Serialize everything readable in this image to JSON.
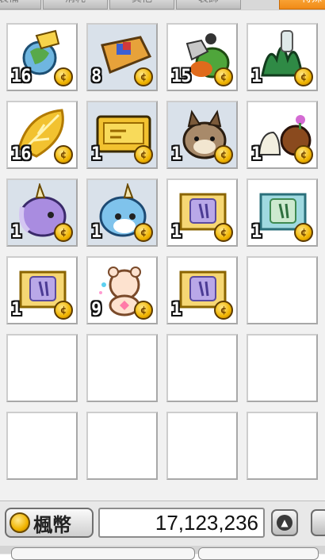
{
  "tabs": [
    {
      "label": "裝備",
      "active": false
    },
    {
      "label": "消耗",
      "active": false
    },
    {
      "label": "其他",
      "active": false
    },
    {
      "label": "裝飾",
      "active": false
    },
    {
      "label": "特殊",
      "active": true
    }
  ],
  "slots": [
    {
      "icon": "globe-cart-icon",
      "qty": "16"
    },
    {
      "icon": "gift-box-cart-icon",
      "qty": "8"
    },
    {
      "icon": "potion-bag-icon",
      "qty": "15"
    },
    {
      "icon": "plant-bottle-icon",
      "qty": "1"
    },
    {
      "icon": "golden-leaf-icon",
      "qty": "16"
    },
    {
      "icon": "golden-ticket-icon",
      "qty": "1"
    },
    {
      "icon": "raccoon-pet-icon",
      "qty": "1"
    },
    {
      "icon": "snail-pet-icon",
      "qty": "1"
    },
    {
      "icon": "purple-unicorn-pet-icon",
      "qty": "1"
    },
    {
      "icon": "blue-unicorn-pet-icon",
      "qty": "1"
    },
    {
      "icon": "purple-scroll-icon",
      "qty": "1"
    },
    {
      "icon": "green-scroll-icon",
      "qty": "1"
    },
    {
      "icon": "purple-scroll-icon",
      "qty": "1"
    },
    {
      "icon": "bear-doll-icon",
      "qty": "9"
    },
    {
      "icon": "purple-scroll-icon",
      "qty": "1"
    },
    {
      "icon": "empty-slot",
      "qty": ""
    },
    {
      "icon": "empty-slot",
      "qty": ""
    },
    {
      "icon": "empty-slot",
      "qty": ""
    },
    {
      "icon": "empty-slot",
      "qty": ""
    },
    {
      "icon": "empty-slot",
      "qty": ""
    },
    {
      "icon": "empty-slot",
      "qty": ""
    },
    {
      "icon": "empty-slot",
      "qty": ""
    },
    {
      "icon": "empty-slot",
      "qty": ""
    },
    {
      "icon": "empty-slot",
      "qty": ""
    }
  ],
  "footer": {
    "meso_label": "楓幣",
    "meso_amount": "17,123,236",
    "coin_icon": "coin-icon",
    "arrow_icon": "arrow-up-icon"
  },
  "colors": {
    "active_tab": "#f08a17",
    "slot_highlight": "#d9e1ea",
    "coin": "#f0b400"
  }
}
